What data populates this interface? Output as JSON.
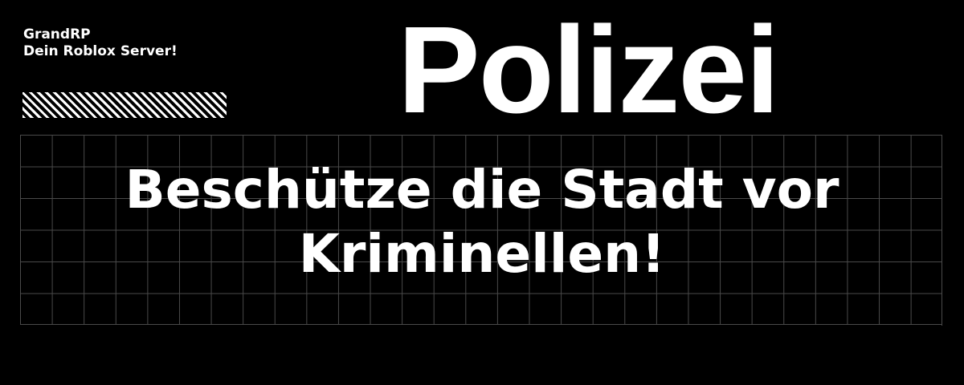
{
  "brand": {
    "line1": "GrandRP",
    "line2": "Dein Roblox Server!"
  },
  "title": "Polizei",
  "slogan": {
    "line1": "Beschütze die Stadt vor",
    "line2": "Kriminellen!"
  },
  "colors": {
    "background": "#000000",
    "text": "#ffffff",
    "grid": "#4a4a4a"
  },
  "icons": {
    "hatch": "diagonal-stripes-bar"
  }
}
